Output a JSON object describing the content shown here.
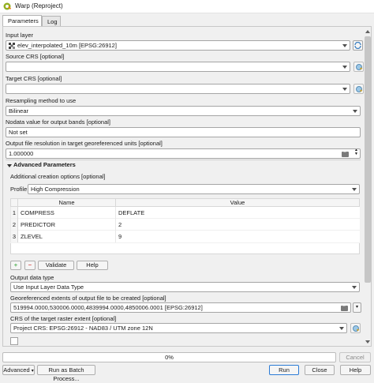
{
  "window": {
    "title": "Warp (Reproject)"
  },
  "tabs": [
    {
      "label": "Parameters"
    },
    {
      "label": "Log"
    }
  ],
  "params": {
    "input_layer": {
      "label": "Input layer",
      "value": "elev_interpolated_10m [EPSG:26912]",
      "more_label": "..."
    },
    "source_crs": {
      "label": "Source CRS [optional]",
      "value": ""
    },
    "target_crs": {
      "label": "Target CRS [optional]",
      "value": ""
    },
    "resampling": {
      "label": "Resampling method to use",
      "value": "Bilinear"
    },
    "nodata": {
      "label": "Nodata value for output bands [optional]",
      "value": "Not set"
    },
    "resolution": {
      "label": "Output file resolution in target georeferenced units [optional]",
      "value": "1.000000"
    }
  },
  "advanced": {
    "title": "Advanced Parameters",
    "creation_label": "Additional creation options [optional]",
    "profile_label": "Profile",
    "profile_value": "High Compression",
    "columns": [
      "Name",
      "Value"
    ],
    "rows": [
      {
        "num": "1",
        "name": "COMPRESS",
        "value": "DEFLATE"
      },
      {
        "num": "2",
        "name": "PREDICTOR",
        "value": "2"
      },
      {
        "num": "3",
        "name": "ZLEVEL",
        "value": "9"
      }
    ],
    "add_label": "+",
    "remove_label": "−",
    "validate_label": "Validate",
    "help_label": "Help",
    "data_type_label": "Output data type",
    "data_type_value": "Use Input Layer Data Type",
    "extent_label": "Georeferenced extents of output file to be created [optional]",
    "extent_value": "519994.0000,530006.0000,4839994.0000,4850006.0001 [EPSG:26912]",
    "extent_crs_label": "CRS of the target raster extent [optional]",
    "extent_crs_value": "Project CRS: EPSG:26912 - NAD83 / UTM zone 12N"
  },
  "progress": {
    "text": "0%",
    "value": 0
  },
  "footer": {
    "cancel_label": "Cancel",
    "advanced_label": "Advanced",
    "batch_label": "Run as Batch Process...",
    "run_label": "Run",
    "close_label": "Close",
    "help_label": "Help"
  },
  "colors": {
    "accent": "#2b7bd6",
    "panel": "#f0f0f0",
    "add_green": "#4caf50",
    "remove_red": "#d9534f"
  }
}
